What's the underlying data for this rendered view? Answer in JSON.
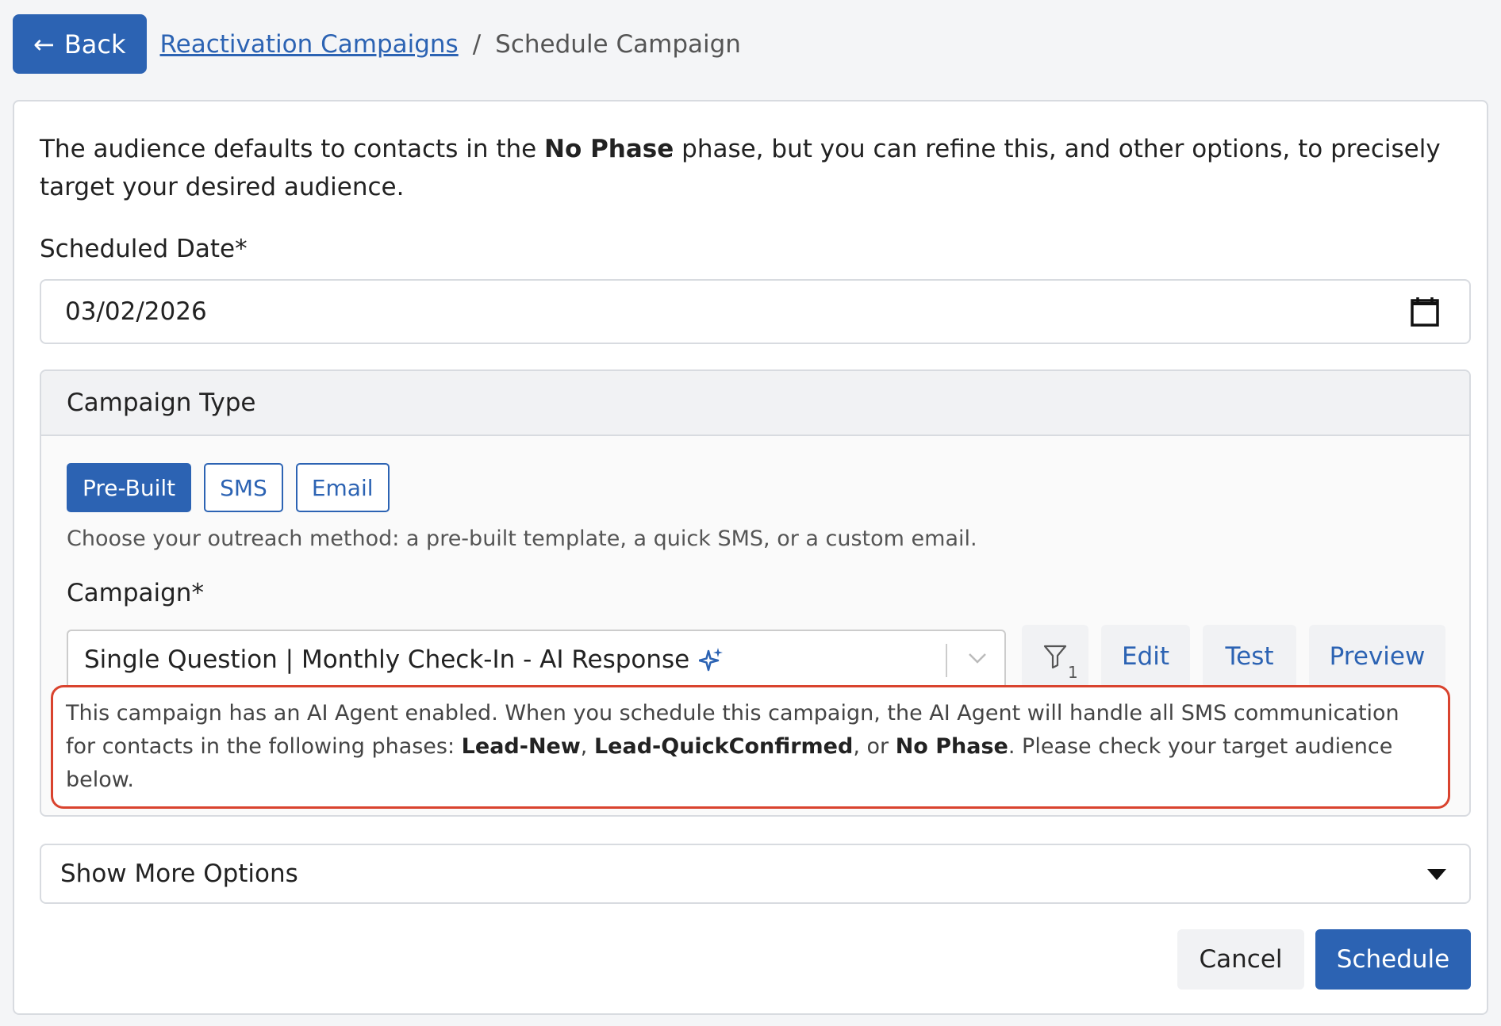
{
  "header": {
    "back_label": "Back",
    "breadcrumb_link": "Reactivation Campaigns",
    "breadcrumb_separator": "/",
    "breadcrumb_current": "Schedule Campaign"
  },
  "intro": {
    "before": "The audience defaults to contacts in the ",
    "phase": "No Phase",
    "after": " phase, but you can refine this, and other options, to precisely target your desired audience."
  },
  "scheduled_date": {
    "label": "Scheduled Date*",
    "value": "03/02/2026"
  },
  "campaign_type": {
    "header": "Campaign Type",
    "buttons": [
      "Pre-Built",
      "SMS",
      "Email"
    ],
    "active": "Pre-Built",
    "help": "Choose your outreach method: a pre-built template, a quick SMS, or a custom email."
  },
  "campaign": {
    "label": "Campaign*",
    "selected": "Single Question | Monthly Check-In - AI Response",
    "filter_count": "1",
    "edit_label": "Edit",
    "test_label": "Test",
    "preview_label": "Preview"
  },
  "ai_alert": {
    "part1": "This campaign has an AI Agent enabled. When you schedule this campaign, the AI Agent will handle all SMS communication for contacts in the following phases: ",
    "phase1": "Lead-New",
    "sep1": ", ",
    "phase2": "Lead-QuickConfirmed",
    "sep2": ", or ",
    "phase3": "No Phase",
    "part2": ". Please check your target audience below."
  },
  "more_options": {
    "label": "Show More Options"
  },
  "actions": {
    "cancel_label": "Cancel",
    "schedule_label": "Schedule"
  },
  "icons": {
    "back": "arrow-left-icon",
    "calendar": "calendar-icon",
    "sparkle": "sparkle-icon",
    "chevron": "chevron-down-icon",
    "filter": "filter-icon",
    "caret": "caret-down-icon"
  },
  "colors": {
    "primary": "#2c63b3",
    "alert_border": "#d9432e"
  }
}
